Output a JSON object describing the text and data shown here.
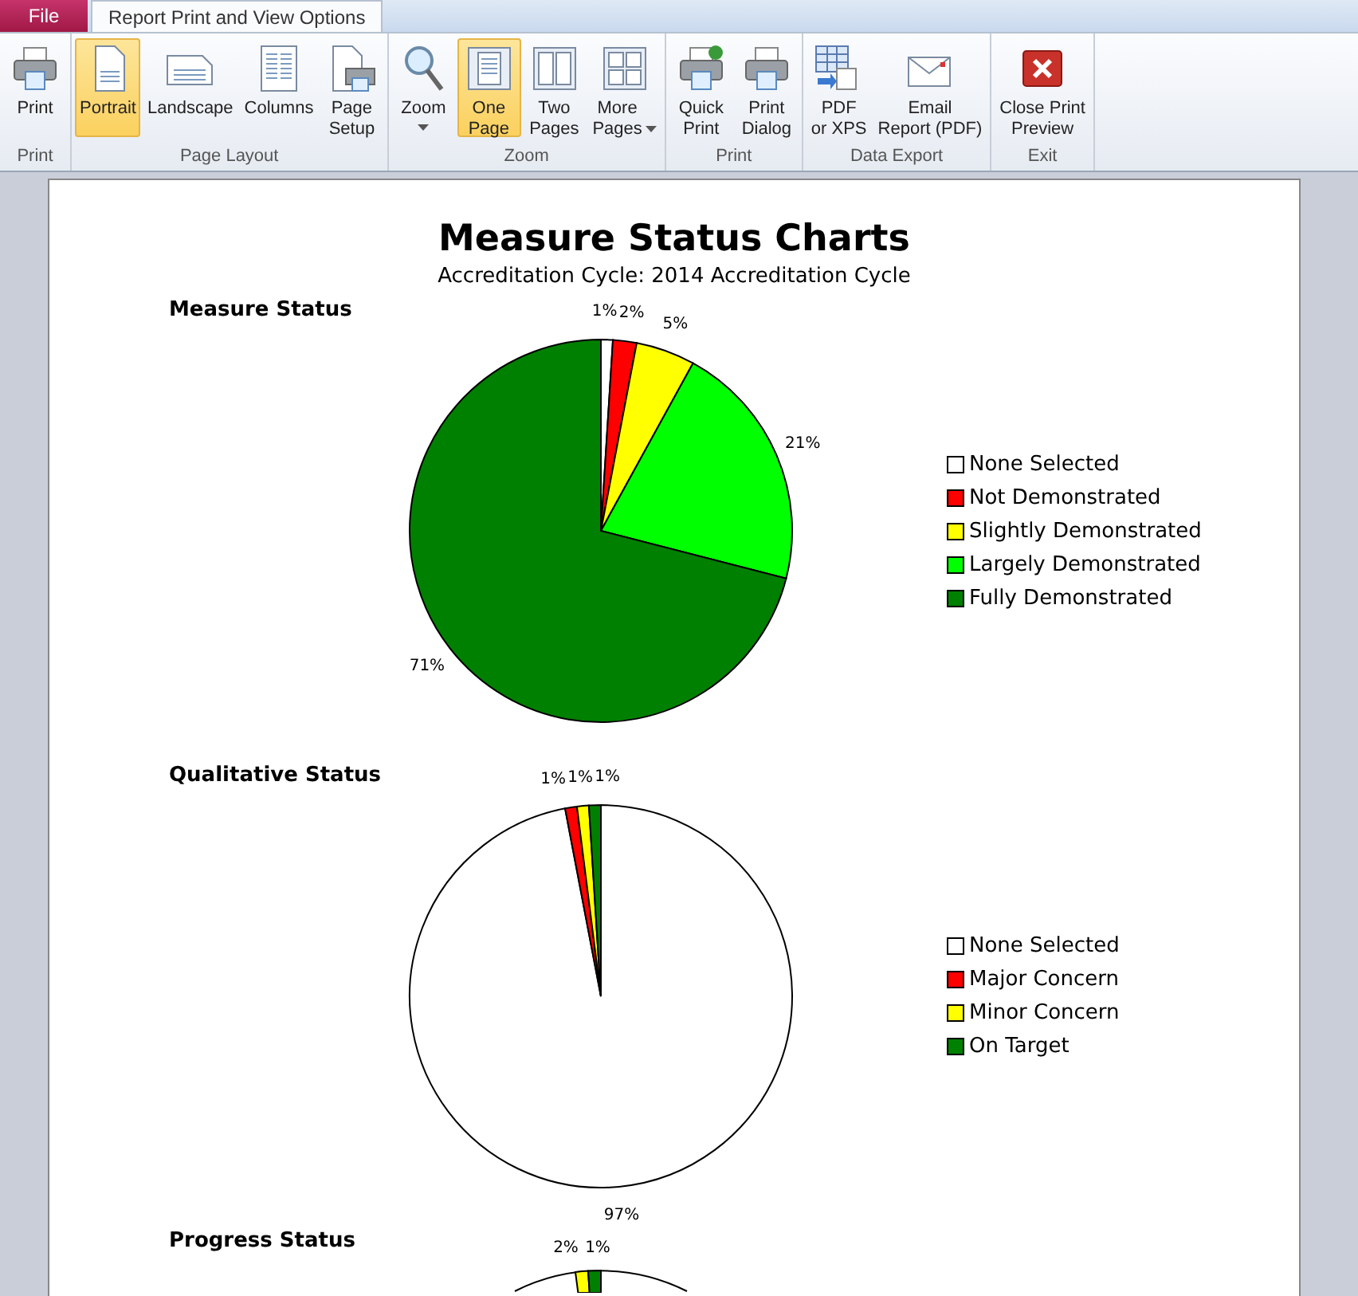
{
  "tabs": [
    {
      "label": "File",
      "kind": "file",
      "selected": false
    },
    {
      "label": "Report Print and View Options",
      "kind": "tab",
      "selected": true
    }
  ],
  "ribbon_groups": [
    {
      "label": "Print",
      "buttons": [
        {
          "label": "Print",
          "selected": false,
          "dropdown": false
        }
      ]
    },
    {
      "label": "Page Layout",
      "buttons": [
        {
          "label": "Portrait",
          "selected": true,
          "dropdown": false
        },
        {
          "label": "Landscape",
          "selected": false,
          "dropdown": false
        },
        {
          "label": "Columns",
          "selected": false,
          "dropdown": false
        },
        {
          "label": "Page\nSetup",
          "selected": false,
          "dropdown": false
        }
      ]
    },
    {
      "label": "Zoom",
      "buttons": [
        {
          "label": "Zoom",
          "selected": false,
          "dropdown": true
        },
        {
          "label": "One\nPage",
          "selected": true,
          "dropdown": false
        },
        {
          "label": "Two\nPages",
          "selected": false,
          "dropdown": false
        },
        {
          "label": "More\nPages",
          "selected": false,
          "dropdown": true
        }
      ]
    },
    {
      "label": "Print",
      "buttons": [
        {
          "label": "Quick\nPrint",
          "selected": false,
          "dropdown": false
        },
        {
          "label": "Print\nDialog",
          "selected": false,
          "dropdown": false
        }
      ]
    },
    {
      "label": "Data Export",
      "buttons": [
        {
          "label": "PDF\nor XPS",
          "selected": false,
          "dropdown": false
        },
        {
          "label": "Email\nReport (PDF)",
          "selected": false,
          "dropdown": false
        }
      ]
    },
    {
      "label": "Exit",
      "buttons": [
        {
          "label": "Close Print\nPreview",
          "selected": false,
          "dropdown": false
        }
      ]
    }
  ],
  "report": {
    "title": "Measure Status Charts",
    "subtitle": "Accreditation Cycle: 2014 Accreditation Cycle",
    "charts": [
      {
        "chart_data": {
          "type": "pie",
          "title": "Measure Status",
          "categories": [
            "None Selected",
            "Not Demonstrated",
            "Slightly Demonstrated",
            "Largely Demonstrated",
            "Fully Demonstrated"
          ],
          "values": [
            1,
            2,
            5,
            21,
            71
          ],
          "value_labels": [
            "1%",
            "2%",
            "5%",
            "21%",
            "71%"
          ],
          "legend": "right"
        },
        "slices": [
          {
            "color": "#ffffff"
          },
          {
            "color": "#ff0000"
          },
          {
            "color": "#ffff00"
          },
          {
            "color": "#00ff00"
          },
          {
            "color": "#008000"
          }
        ]
      },
      {
        "chart_data": {
          "type": "pie",
          "title": "Qualitative Status",
          "categories": [
            "None Selected",
            "Major Concern",
            "Minor Concern",
            "On Target"
          ],
          "values": [
            97,
            1,
            1,
            1
          ],
          "value_labels": [
            "97%",
            "1%",
            "1%",
            "1%"
          ],
          "legend": "right"
        },
        "slices": [
          {
            "color": "#ffffff"
          },
          {
            "color": "#ff0000"
          },
          {
            "color": "#ffff00"
          },
          {
            "color": "#008000"
          }
        ]
      }
    ],
    "cut_off_chart": {
      "title": "Progress Status",
      "visible_labels": [
        "2%",
        "1%"
      ]
    }
  }
}
